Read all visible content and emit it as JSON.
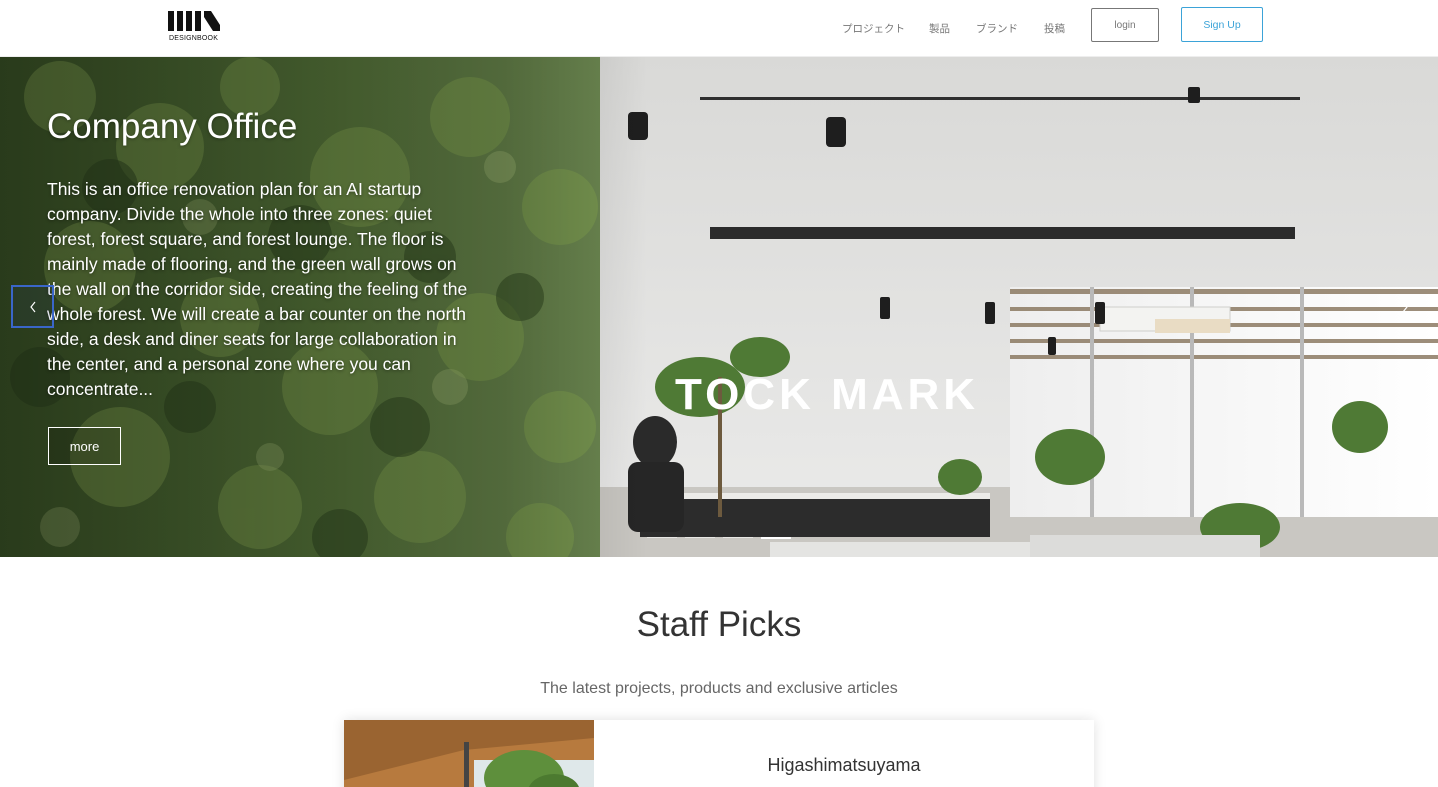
{
  "header": {
    "logo_text": "DESIGNBOOK",
    "nav": [
      "プロジェクト",
      "製品",
      "ブランド",
      "投稿"
    ],
    "login_label": "login",
    "signup_label": "Sign Up"
  },
  "hero": {
    "title": "Company Office",
    "description": "This is an office renovation plan for an AI startup company. Divide the whole into three zones: quiet forest, forest square, and forest lounge. The floor is mainly made of flooring, and the green wall grows on the wall on the corridor side, creating the feeling of the whole forest. We will create a bar counter on the north side, a desk and diner seats for large collaboration in the center, and a personal zone where you can concentrate...",
    "sign_text": "TOCK MARK",
    "more_label": "more",
    "slide_count": 4,
    "active_slide": 4
  },
  "staff_picks": {
    "title": "Staff Picks",
    "subtitle": "The latest projects, products and exclusive articles",
    "cards": [
      {
        "title": "Higashimatsuyama"
      }
    ]
  },
  "colors": {
    "accent": "#3ba3d8",
    "focus_outline": "#3a66c9",
    "text": "#333333"
  },
  "icons": {
    "prev": "chevron-left-icon",
    "next": "chevron-right-icon"
  }
}
